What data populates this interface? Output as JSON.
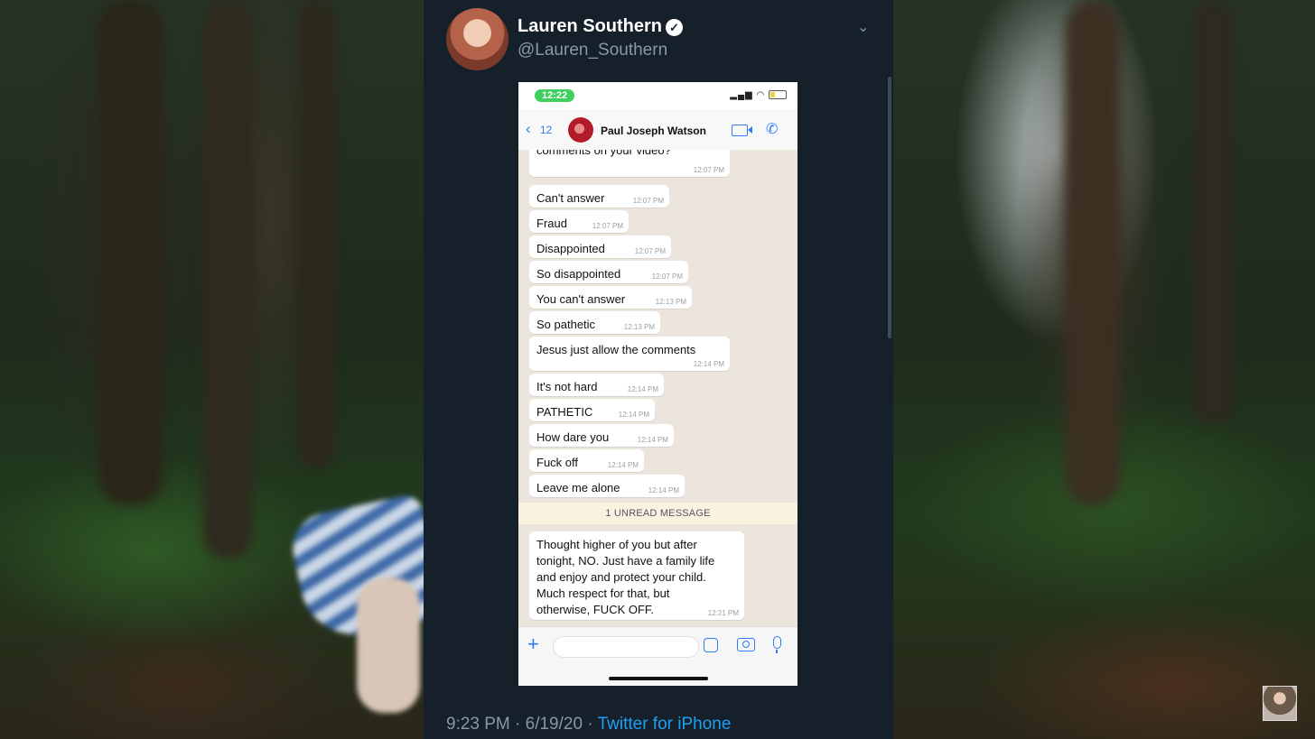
{
  "tweet": {
    "author_name": "Lauren Southern",
    "handle": "@Lauren_Southern",
    "verified_glyph": "✓",
    "caret_glyph": "⌄",
    "timestamp": "9:23 PM · 6/19/20 · ",
    "source": "Twitter for iPhone"
  },
  "phone": {
    "time": "12:22",
    "back_glyph": "‹",
    "back_count": "12",
    "contact_name": "Paul Joseph  Watson",
    "messages": [
      {
        "text": "comments on your video?",
        "time": "12:07 PM"
      },
      {
        "text": "Can't answer",
        "time": "12:07 PM"
      },
      {
        "text": "Fraud",
        "time": "12:07 PM"
      },
      {
        "text": "Disappointed",
        "time": "12:07 PM"
      },
      {
        "text": "So disappointed",
        "time": "12:07 PM"
      },
      {
        "text": "You can't answer",
        "time": "12:13 PM"
      },
      {
        "text": "So pathetic",
        "time": "12:13 PM"
      },
      {
        "text": "Jesus just allow the comments",
        "time": "12:14 PM"
      },
      {
        "text": "It's not hard",
        "time": "12:14 PM"
      },
      {
        "text": "PATHETIC",
        "time": "12:14 PM"
      },
      {
        "text": "How dare you",
        "time": "12:14 PM"
      },
      {
        "text": "Fuck off",
        "time": "12:14 PM"
      },
      {
        "text": "Leave me alone",
        "time": "12:14 PM"
      },
      {
        "text": "Thought higher of you but after\ntonight, NO. Just have a family life\nand enjoy and protect your child.\nMuch respect for that, but\notherwise, FUCK OFF.",
        "time": "12:21 PM"
      }
    ],
    "unread_banner": "1 UNREAD MESSAGE",
    "plus_glyph": "+"
  },
  "icons": {
    "phone_glyph": "✆"
  },
  "colors": {
    "tweet_bg": "#15202b",
    "link_blue": "#1da1f2",
    "ios_blue": "#2e7cf6",
    "chat_bg": "#ece5dd",
    "status_green": "#3fcf5c"
  }
}
